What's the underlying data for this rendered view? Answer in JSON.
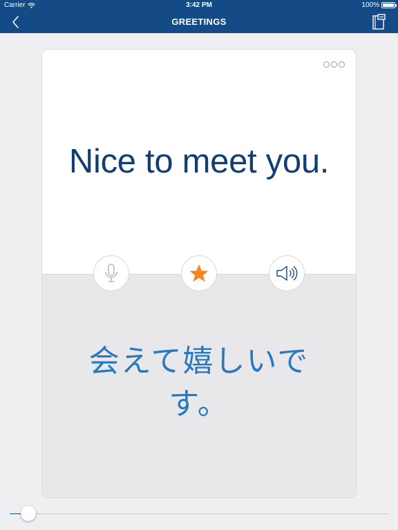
{
  "status_bar": {
    "carrier": "Carrier",
    "time": "3:42 PM",
    "battery": "100%",
    "battery_level": 1.0
  },
  "nav": {
    "title": "GREETINGS",
    "back_icon": "chevron-left-icon",
    "notebook_icon": "notebook-icon"
  },
  "card": {
    "english": "Nice to meet you.",
    "japanese": "会えて嬉しいです。",
    "buttons": {
      "record_icon": "microphone-icon",
      "favorite_icon": "star-icon",
      "play_icon": "speaker-icon"
    }
  },
  "slider": {
    "progress": 0.05
  },
  "colors": {
    "brand": "#144a85",
    "english_text": "#123f73",
    "japanese_text": "#2a79bf",
    "star": "#f5861f"
  }
}
